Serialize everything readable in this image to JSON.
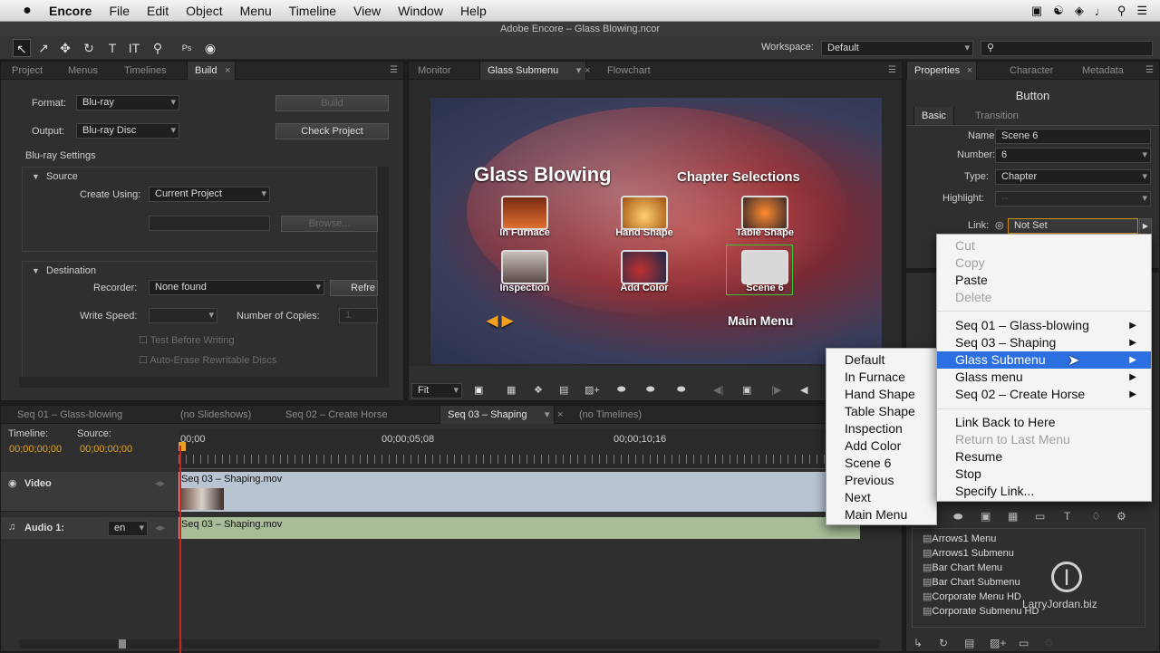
{
  "menubar": {
    "apple": "",
    "app": "Encore",
    "items": [
      "File",
      "Edit",
      "Object",
      "Menu",
      "Timeline",
      "View",
      "Window",
      "Help"
    ]
  },
  "titlebar": {
    "title": "Adobe Encore – Glass Blowing.ncor"
  },
  "workspace": {
    "label": "Workspace:",
    "value": "Default"
  },
  "left_tabs": [
    "Project",
    "Menus",
    "Timelines",
    "Build"
  ],
  "build": {
    "format_label": "Format:",
    "format_value": "Blu-ray",
    "output_label": "Output:",
    "output_value": "Blu-ray Disc",
    "build_button": "Build",
    "check_button": "Check Project",
    "settings_title": "Blu-ray Settings",
    "source_title": "Source",
    "create_using_label": "Create Using:",
    "create_using_value": "Current Project",
    "browse_button": "Browse...",
    "destination_title": "Destination",
    "recorder_label": "Recorder:",
    "recorder_value": "None found",
    "refresh_button": "Refre",
    "write_speed_label": "Write Speed:",
    "copies_label": "Number of Copies:",
    "copies_value": "1",
    "test_before": "Test Before Writing",
    "auto_erase": "Auto-Erase Rewritable Discs"
  },
  "center_tabs": [
    "Monitor",
    "Glass Submenu",
    "Flowchart"
  ],
  "monitor": {
    "title": "Glass Blowing",
    "chapter_title": "Chapter Selections",
    "main_menu": "Main Menu",
    "thumbs": [
      "In Furnace",
      "Hand Shape",
      "Table Shape",
      "Inspection",
      "Add Color",
      "Scene 6"
    ],
    "fit": "Fit"
  },
  "right_tabs": [
    "Properties",
    "Character",
    "Metadata"
  ],
  "properties": {
    "header": "Button",
    "subtabs": [
      "Basic",
      "Transition"
    ],
    "name_label": "Name:",
    "name_value": "Scene 6",
    "number_label": "Number:",
    "number_value": "6",
    "type_label": "Type:",
    "type_value": "Chapter",
    "highlight_label": "Highlight:",
    "highlight_value": "--",
    "link_label": "Link:",
    "link_value": "Not Set"
  },
  "timeline_tabs": [
    "Seq 01 – Glass-blowing",
    "(no Slideshows)",
    "Seq 02 – Create Horse",
    "Seq 03 – Shaping",
    "(no Timelines)"
  ],
  "timeline": {
    "timeline_label": "Timeline:",
    "source_label": "Source:",
    "timeline_tc": "00;00;00;00",
    "source_tc": "00;00;00;00",
    "ruler": [
      "00;00",
      "00;00;05;08",
      "00;00;10;16"
    ],
    "video_track": "Video",
    "audio_track": "Audio 1:",
    "audio_lang": "en",
    "video_clip": "Seq 03 – Shaping.mov",
    "audio_clip": "Seq 03 – Shaping.mov"
  },
  "link_menu": {
    "edit_items": [
      {
        "label": "Cut",
        "enabled": false
      },
      {
        "label": "Copy",
        "enabled": false
      },
      {
        "label": "Paste",
        "enabled": true
      },
      {
        "label": "Delete",
        "enabled": false
      }
    ],
    "targets": [
      {
        "label": "Seq 01 – Glass-blowing",
        "highlight": false
      },
      {
        "label": "Seq 03 – Shaping",
        "highlight": false
      },
      {
        "label": "Glass Submenu",
        "highlight": true
      },
      {
        "label": "Glass menu",
        "highlight": false
      },
      {
        "label": "Seq 02 – Create Horse",
        "highlight": false
      }
    ],
    "actions": [
      {
        "label": "Link Back to Here",
        "enabled": true
      },
      {
        "label": "Return to Last Menu",
        "enabled": false
      },
      {
        "label": "Resume",
        "enabled": true
      },
      {
        "label": "Stop",
        "enabled": true
      },
      {
        "label": "Specify Link...",
        "enabled": true
      }
    ]
  },
  "submenu": [
    "Default",
    "In Furnace",
    "Hand Shape",
    "Table Shape",
    "Inspection",
    "Add Color",
    "Scene 6",
    "Previous",
    "Next",
    "Main Menu"
  ],
  "library": [
    "Arrows1 Menu",
    "Arrows1 Submenu",
    "Bar Chart Menu",
    "Bar Chart Submenu",
    "Corporate Menu HD",
    "Corporate Submenu HD"
  ],
  "watermark": "LarryJordan.biz",
  "colors": {
    "highlight": "#2c6fe0",
    "timecode": "#e8a320",
    "playhead": "#d02020"
  }
}
